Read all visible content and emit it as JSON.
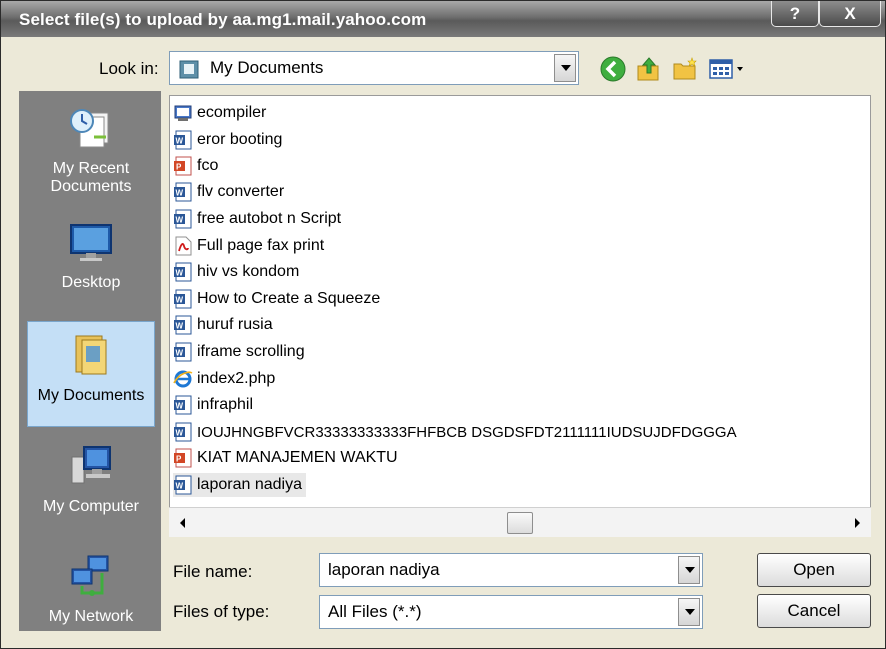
{
  "window": {
    "title": "Select file(s) to upload by aa.mg1.mail.yahoo.com",
    "help_button": "?",
    "close_button": "X"
  },
  "look_in": {
    "label": "Look in:",
    "value": "My Documents"
  },
  "places": [
    {
      "line1": "My Recent",
      "line2": "Documents"
    },
    {
      "line1": "Desktop",
      "line2": ""
    },
    {
      "line1": "My Documents",
      "line2": ""
    },
    {
      "line1": "My Computer",
      "line2": ""
    },
    {
      "line1": "My Network",
      "line2": ""
    }
  ],
  "files": [
    {
      "name": "ecompiler",
      "icon": "program-icon"
    },
    {
      "name": "eror booting",
      "icon": "word-document-icon"
    },
    {
      "name": "fco",
      "icon": "powerpoint-icon"
    },
    {
      "name": "flv converter",
      "icon": "word-document-icon"
    },
    {
      "name": "free autobot n Script",
      "icon": "word-document-icon"
    },
    {
      "name": "Full page fax print",
      "icon": "pdf-icon"
    },
    {
      "name": "hiv vs  kondom",
      "icon": "word-document-icon"
    },
    {
      "name": "How to Create a Squeeze",
      "icon": "word-document-icon"
    },
    {
      "name": "huruf rusia",
      "icon": "word-document-icon"
    },
    {
      "name": "iframe scrolling",
      "icon": "word-document-icon"
    },
    {
      "name": "index2.php",
      "icon": "internet-explorer-icon"
    },
    {
      "name": "infraphil",
      "icon": "word-document-icon"
    },
    {
      "name": "IOUJHNGBFVCR33333333333FHFBCB DSGDSFDT2111111IUDSUJDFDGGGA",
      "icon": "word-document-icon"
    },
    {
      "name": "KIAT MANAJEMEN WAKTU",
      "icon": "powerpoint-icon"
    },
    {
      "name": "laporan nadiya",
      "icon": "word-document-icon"
    }
  ],
  "file_name": {
    "label": "File name:",
    "value": "laporan nadiya"
  },
  "file_type": {
    "label": "Files of type:",
    "value": "All Files (*.*)"
  },
  "buttons": {
    "open": "Open",
    "cancel": "Cancel"
  }
}
